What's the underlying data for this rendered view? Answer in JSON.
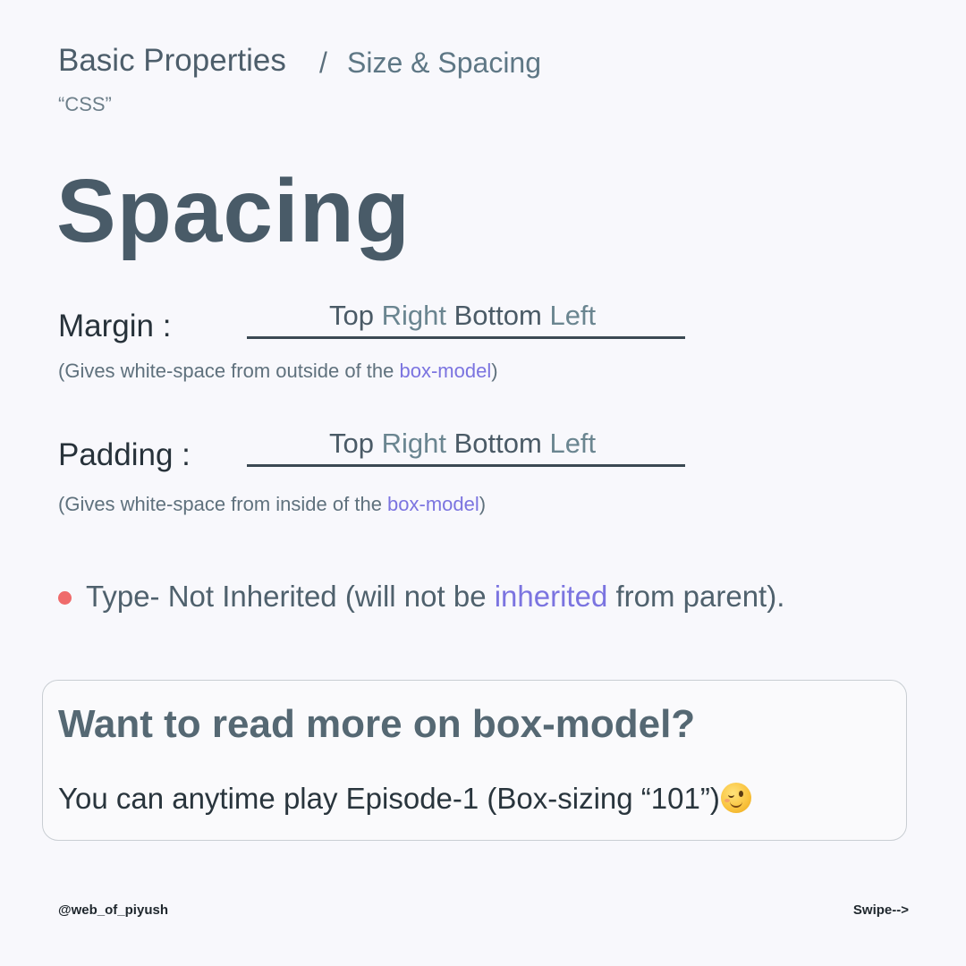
{
  "breadcrumb": {
    "main": "Basic Properties",
    "separator": "/",
    "sub": "Size & Spacing"
  },
  "tag": "“CSS”",
  "title": "Spacing",
  "margin": {
    "label": "Margin :",
    "values": [
      "Top",
      "Right",
      "Bottom",
      "Left"
    ],
    "desc_prefix": "(Gives white-space from outside of the ",
    "desc_link": "box-model",
    "desc_suffix": ")"
  },
  "padding": {
    "label": "Padding :",
    "values": [
      "Top",
      "Right",
      "Bottom",
      "Left"
    ],
    "desc_prefix": "(Gives white-space from inside of the ",
    "desc_link": "box-model",
    "desc_suffix": ")"
  },
  "bullet": {
    "prefix": "Type- Not Inherited (will not be ",
    "link": "inherited",
    "suffix": " from parent)."
  },
  "card": {
    "title": "Want to read more on box-model?",
    "body": "You can anytime play Episode-1 (Box-sizing “101”)",
    "emoji_icon": "winking-face-icon"
  },
  "footer": {
    "handle": "@web_of_piyush",
    "swipe": "Swipe-->"
  },
  "colors": {
    "background": "#f8f8fc",
    "link": "#7b74e0",
    "bullet": "#ef6b6b",
    "heading": "#495b68"
  }
}
